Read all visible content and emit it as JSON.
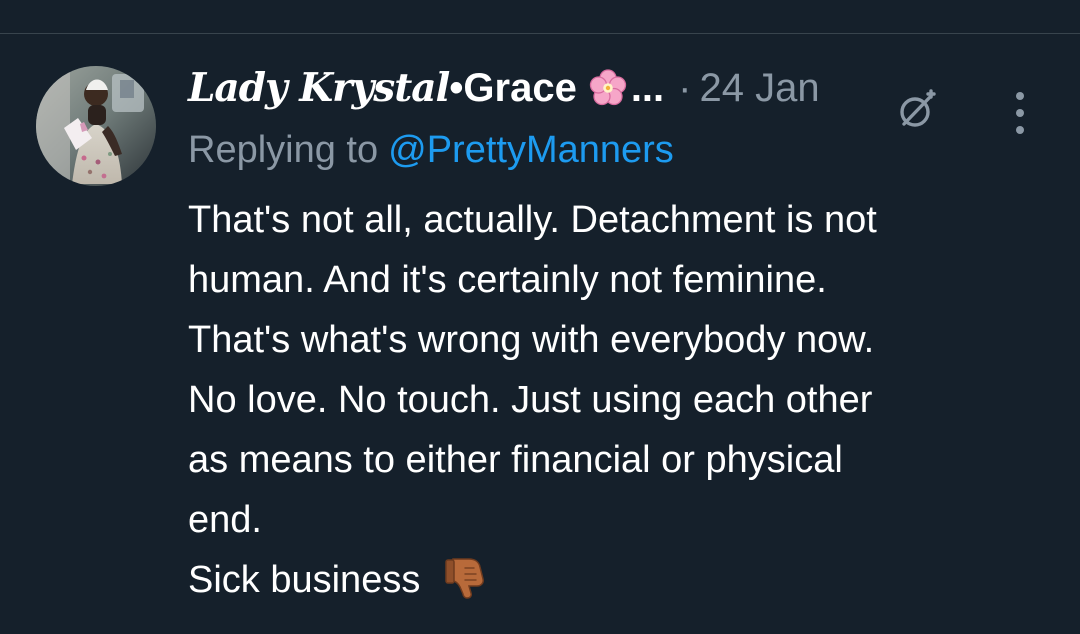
{
  "tweet": {
    "author": {
      "script_name": "Lady Krystal",
      "dot": "•",
      "display_name": "Grace",
      "flower_icon": "cherry-blossom-icon",
      "ellipsis": "..."
    },
    "separator": "·",
    "date": "24 Jan",
    "reply_label": "Replying to",
    "reply_handle": "@PrettyManners",
    "body_lines": [
      "That's not all, actually. Detachment is not",
      "human. And it's certainly not feminine.",
      "That's what's wrong with everybody now.",
      "No love. No touch. Just using each other",
      "as means to either financial or physical",
      "end."
    ],
    "closing_text": "Sick business",
    "closing_icon": "thumbs-down-icon"
  },
  "icons": {
    "grok": "grok-icon",
    "more": "more-options-icon"
  },
  "colors": {
    "background": "#15202b",
    "text": "#ffffff",
    "muted": "#8b98a5",
    "link": "#1d9bf0"
  }
}
